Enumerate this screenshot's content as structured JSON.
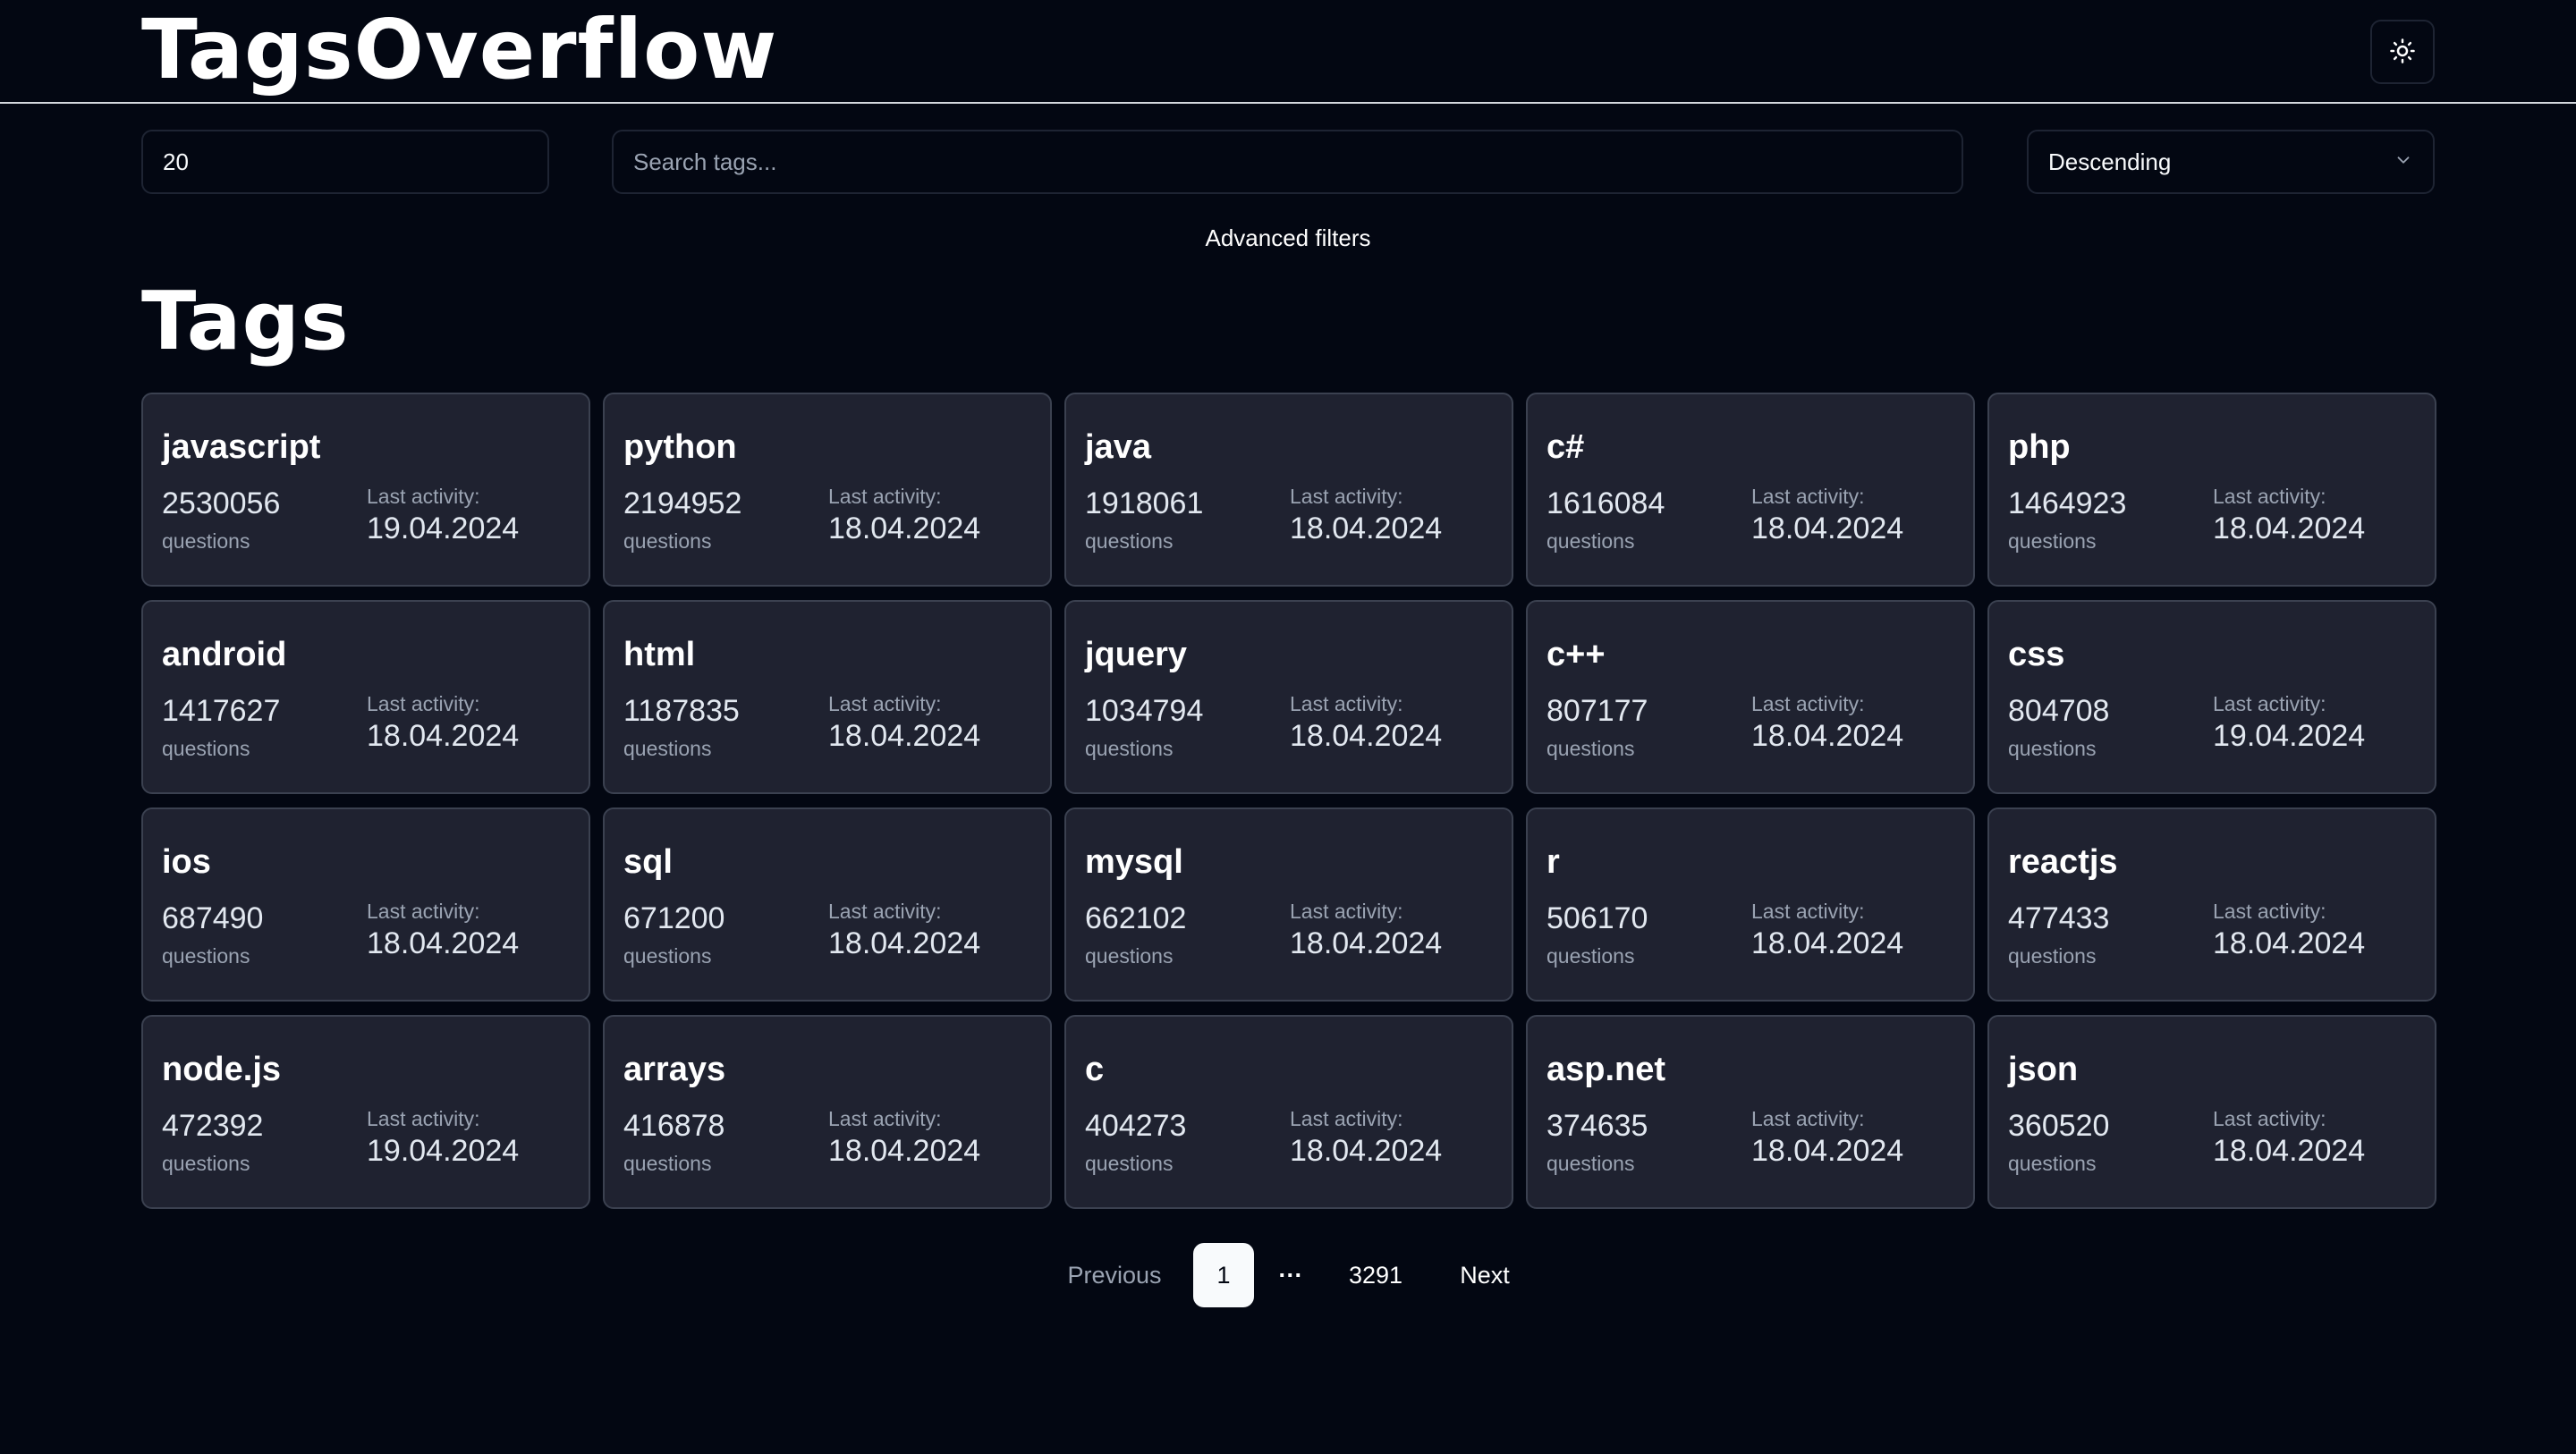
{
  "header": {
    "app_title": "TagsOverflow",
    "theme_icon": "sun-icon"
  },
  "filters": {
    "page_size_value": "20",
    "search_placeholder": "Search tags...",
    "sort_value": "Descending",
    "advanced_label": "Advanced filters"
  },
  "main": {
    "title": "Tags",
    "count_label": "questions",
    "activity_label": "Last activity:",
    "tags": [
      {
        "name": "javascript",
        "count": "2530056",
        "date": "19.04.2024"
      },
      {
        "name": "python",
        "count": "2194952",
        "date": "18.04.2024"
      },
      {
        "name": "java",
        "count": "1918061",
        "date": "18.04.2024"
      },
      {
        "name": "c#",
        "count": "1616084",
        "date": "18.04.2024"
      },
      {
        "name": "php",
        "count": "1464923",
        "date": "18.04.2024"
      },
      {
        "name": "android",
        "count": "1417627",
        "date": "18.04.2024"
      },
      {
        "name": "html",
        "count": "1187835",
        "date": "18.04.2024"
      },
      {
        "name": "jquery",
        "count": "1034794",
        "date": "18.04.2024"
      },
      {
        "name": "c++",
        "count": "807177",
        "date": "18.04.2024"
      },
      {
        "name": "css",
        "count": "804708",
        "date": "19.04.2024"
      },
      {
        "name": "ios",
        "count": "687490",
        "date": "18.04.2024"
      },
      {
        "name": "sql",
        "count": "671200",
        "date": "18.04.2024"
      },
      {
        "name": "mysql",
        "count": "662102",
        "date": "18.04.2024"
      },
      {
        "name": "r",
        "count": "506170",
        "date": "18.04.2024"
      },
      {
        "name": "reactjs",
        "count": "477433",
        "date": "18.04.2024"
      },
      {
        "name": "node.js",
        "count": "472392",
        "date": "19.04.2024"
      },
      {
        "name": "arrays",
        "count": "416878",
        "date": "18.04.2024"
      },
      {
        "name": "c",
        "count": "404273",
        "date": "18.04.2024"
      },
      {
        "name": "asp.net",
        "count": "374635",
        "date": "18.04.2024"
      },
      {
        "name": "json",
        "count": "360520",
        "date": "18.04.2024"
      }
    ]
  },
  "pagination": {
    "previous_label": "Previous",
    "current_page": "1",
    "ellipsis": "···",
    "last_page": "3291",
    "next_label": "Next"
  },
  "colors": {
    "background": "#030712",
    "card_background": "#1f2230",
    "card_border": "#3b4150",
    "muted_text": "#9aa3b2",
    "active_page_background": "#f8fafc"
  }
}
